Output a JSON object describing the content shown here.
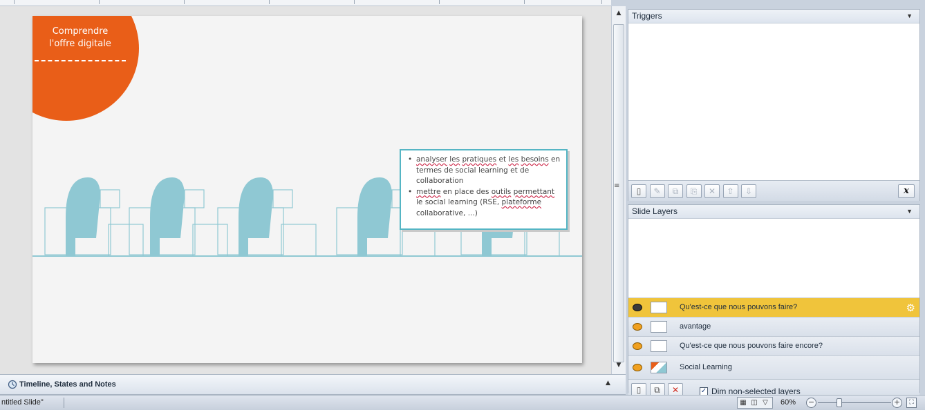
{
  "slide": {
    "title_line1": "Comprendre",
    "title_line2": "l'offre digitale",
    "bullets": [
      {
        "segments": [
          {
            "text": "analyser",
            "spell": true
          },
          {
            "text": " "
          },
          {
            "text": "les",
            "spell": true
          },
          {
            "text": " "
          },
          {
            "text": "pratiques",
            "spell": true
          },
          {
            "text": " et "
          },
          {
            "text": "les",
            "spell": true
          },
          {
            "text": " "
          },
          {
            "text": "besoins",
            "spell": true
          },
          {
            "text": " en termes de social learning et de collaboration"
          }
        ]
      },
      {
        "segments": [
          {
            "text": "mettre",
            "spell": true
          },
          {
            "text": " en place des "
          },
          {
            "text": "outils",
            "spell": true
          },
          {
            "text": " "
          },
          {
            "text": "permettant",
            "spell": true
          },
          {
            "text": " le social learning (RSE, "
          },
          {
            "text": "plateforme",
            "spell": true
          },
          {
            "text": " collaborative, ...)"
          }
        ]
      }
    ],
    "accent_color": "#e95e18",
    "illustration_color": "#8fc8d3"
  },
  "timeline": {
    "label": "Timeline, States and Notes"
  },
  "triggers": {
    "header": "Triggers",
    "toolbar_icons": [
      "new-trigger-icon",
      "edit-icon",
      "copy-icon",
      "paste-icon",
      "delete-icon",
      "move-up-icon",
      "move-down-icon"
    ],
    "close_label": "x"
  },
  "layers": {
    "header": "Slide Layers",
    "items": [
      {
        "name": "Qu'est-ce que nous pouvons faire?",
        "active": true
      },
      {
        "name": "avantage",
        "active": false
      },
      {
        "name": "Qu'est-ce que nous pouvons faire encore?",
        "active": false
      },
      {
        "name": "Social Learning",
        "active": false,
        "base": true
      }
    ],
    "dim_label": "Dim non-selected layers",
    "dim_checked": true
  },
  "status": {
    "slide_name": "ntitled Slide\"",
    "zoom": "60%",
    "zoom_fraction": 0.25
  }
}
